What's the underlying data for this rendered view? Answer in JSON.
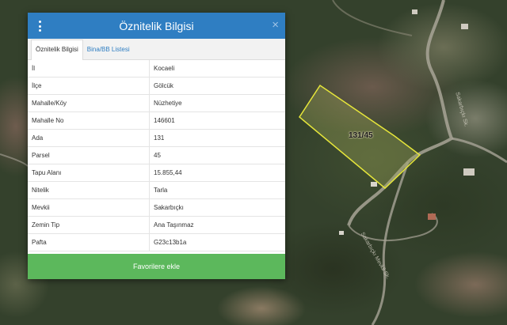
{
  "panel": {
    "title": "Öznitelik Bilgisi",
    "close_symbol": "×",
    "tabs": [
      {
        "label": "Öznitelik Bilgisi",
        "active": true
      },
      {
        "label": "Bina/BB Listesi",
        "active": false
      }
    ],
    "rows": [
      {
        "key": "İl",
        "value": "Kocaeli"
      },
      {
        "key": "İlçe",
        "value": "Gölcük"
      },
      {
        "key": "Mahalle/Köy",
        "value": "Nüzhetiye"
      },
      {
        "key": "Mahalle No",
        "value": "146601"
      },
      {
        "key": "Ada",
        "value": "131"
      },
      {
        "key": "Parsel",
        "value": "45"
      },
      {
        "key": "Tapu Alanı",
        "value": "15.855,44"
      },
      {
        "key": "Nitelik",
        "value": "Tarla"
      },
      {
        "key": "Mevkii",
        "value": "Sakarbıçkı"
      },
      {
        "key": "Zemin Tip",
        "value": "Ana Taşınmaz"
      },
      {
        "key": "Pafta",
        "value": "G23c13b1a"
      }
    ],
    "favorite_button_label": "Favorilere ekle"
  },
  "map": {
    "parcel_label": "131/45",
    "road_label_1": "Sakarbıçkı Sk.",
    "road_label_2": "Sakarbıçkı Mevkii Sk."
  },
  "colors": {
    "header_blue": "#2f7ec2",
    "button_green": "#5cb85c",
    "parcel_outline": "#e6e63a"
  },
  "icons": {
    "menu": "vertical-dots-icon",
    "close": "close-icon"
  }
}
